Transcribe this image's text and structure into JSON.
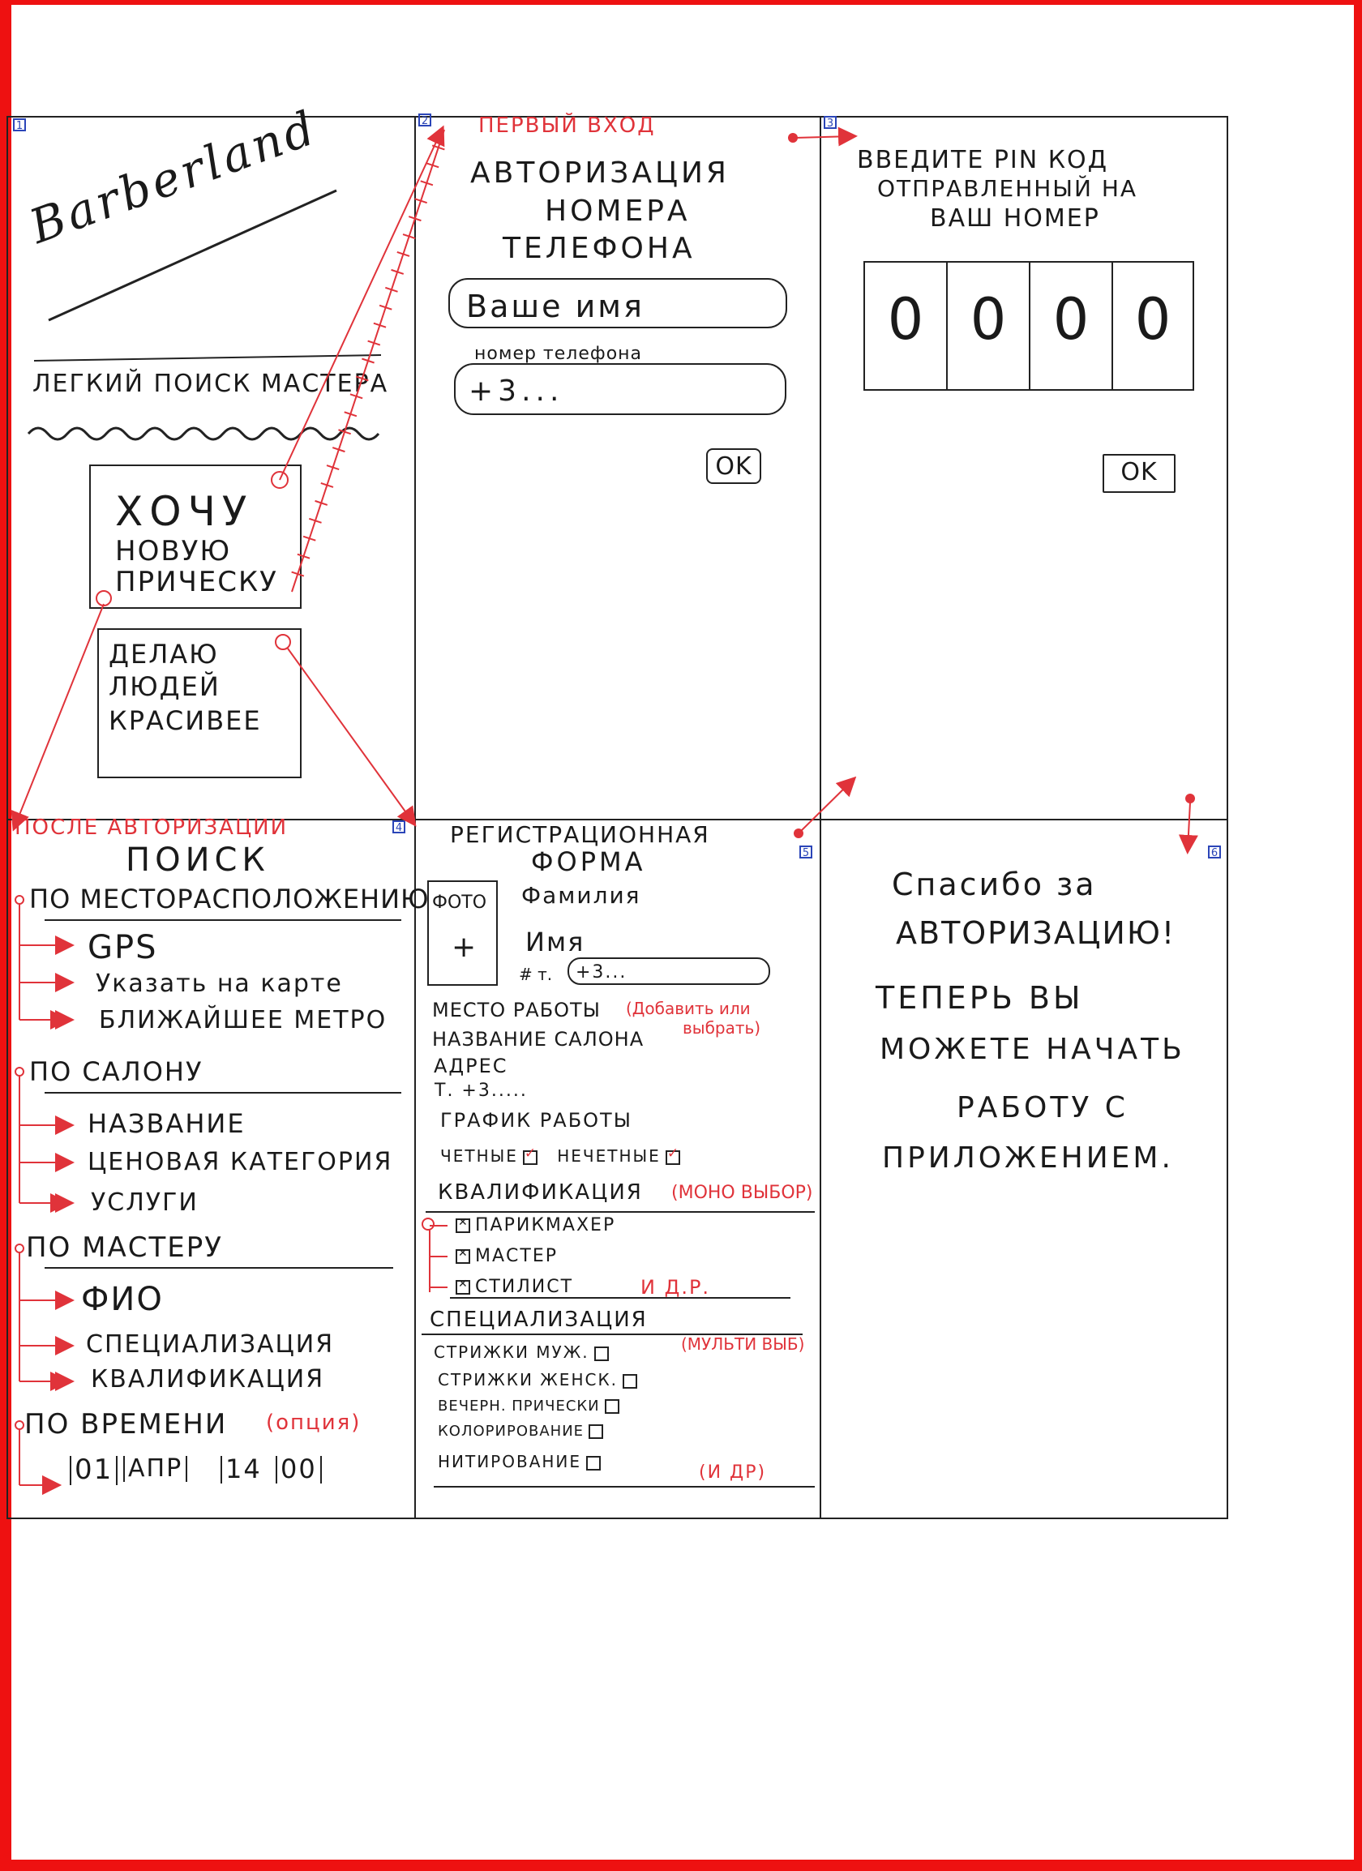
{
  "screen1": {
    "number": "1",
    "logo": "Barberland",
    "tagline": "ЛЕГКИЙ ПОИСК МАСТЕРА",
    "btn_want_line1": "ХОЧУ",
    "btn_want_line2": "НОВУЮ",
    "btn_want_line3": "ПРИЧЕСКУ",
    "btn_make_line1": "ДЕЛАЮ",
    "btn_make_line2": "ЛЮДЕЙ",
    "btn_make_line3": "КРАСИВЕЕ"
  },
  "screen2": {
    "number": "2",
    "annotation": "ПЕРВЫЙ ВХОД",
    "title_line1": "АВТОРИЗАЦИЯ",
    "title_line2": "НОМЕРА",
    "title_line3": "ТЕЛЕФОНА",
    "name_placeholder": "Ваше имя",
    "phone_label": "номер телефона",
    "phone_value": "+3...",
    "ok": "OK"
  },
  "screen3": {
    "number": "3",
    "title_line1": "ВВЕДИТЕ PIN КОД",
    "title_line2": "ОТПРАВЛЕННЫЙ НА",
    "title_line3": "ВАШ НОМЕР",
    "pin": [
      "0",
      "0",
      "0",
      "0"
    ],
    "ok": "OK"
  },
  "screen4": {
    "number": "4",
    "annotation": "ПОСЛЕ АВТОРИЗАЦИИ",
    "title": "ПОИСК",
    "by_location": "ПО МЕСТОРАСПОЛОЖЕНИЮ",
    "location_items": [
      "GPS",
      "Указать на карте",
      "БЛИЖАЙШЕЕ МЕТРО"
    ],
    "by_salon": "ПО САЛОНУ",
    "salon_items": [
      "НАЗВАНИЕ",
      "ЦЕНОВАЯ КАТЕГОРИЯ",
      "УСЛУГИ"
    ],
    "by_master": "ПО МАСТЕРУ",
    "master_items": [
      "ФИО",
      "СПЕЦИАЛИЗАЦИЯ",
      "КВАЛИФИКАЦИЯ"
    ],
    "by_time": "ПО ВРЕМЕНИ",
    "by_time_note": "(опция)",
    "date_day": "01",
    "date_month": "АПР",
    "time_hour": "14",
    "time_min": "00"
  },
  "screen5": {
    "number": "5",
    "title_line1": "РЕГИСТРАЦИОННАЯ",
    "title_line2": "ФОРМА",
    "photo_label": "ФОТО",
    "photo_plus": "+",
    "surname": "Фамилия",
    "name": "Имя",
    "phone_prefix": "# т.",
    "phone_value": "+3...",
    "workplace": "МЕСТО РАБОТЫ",
    "workplace_note1": "(Добавить или",
    "workplace_note2": "выбрать)",
    "salon_name": "НАЗВАНИЕ САЛОНА",
    "address": "АДРЕС",
    "salon_phone": "Т. +3.....",
    "schedule": "ГРАФИК РАБОТЫ",
    "even": "ЧЕТНЫЕ",
    "odd": "НЕЧЕТНЫЕ",
    "qualification": "КВАЛИФИКАЦИЯ",
    "qualification_note": "(МОНО ВЫБОР)",
    "qual_items": [
      "ПАРИКМАХЕР",
      "МАСТЕР",
      "СТИЛИСТ"
    ],
    "qual_more": "И Д.Р.",
    "specialization": "СПЕЦИАЛИЗАЦИЯ",
    "spec_note": "(МУЛЬТИ ВЫБ)",
    "spec_items": [
      "СТРИЖКИ МУЖ.",
      "СТРИЖКИ ЖЕНСК.",
      "ВЕЧЕРН. ПРИЧЕСКИ",
      "КОЛОРИРОВАНИЕ",
      "НИТИРОВАНИЕ"
    ],
    "spec_more": "(И ДР)"
  },
  "screen6": {
    "number": "6",
    "line1": "Спасибо за",
    "line2": "АВТОРИЗАЦИЮ!",
    "line3": "ТЕПЕРЬ ВЫ",
    "line4": "МОЖЕТЕ НАЧАТЬ",
    "line5": "РАБОТУ С",
    "line6": "ПРИЛОЖЕНИЕМ."
  },
  "colors": {
    "ink": "#1a1a1a",
    "annotation": "#e0333a",
    "frame": "#ee1111",
    "number_box": "#2b45b8"
  }
}
